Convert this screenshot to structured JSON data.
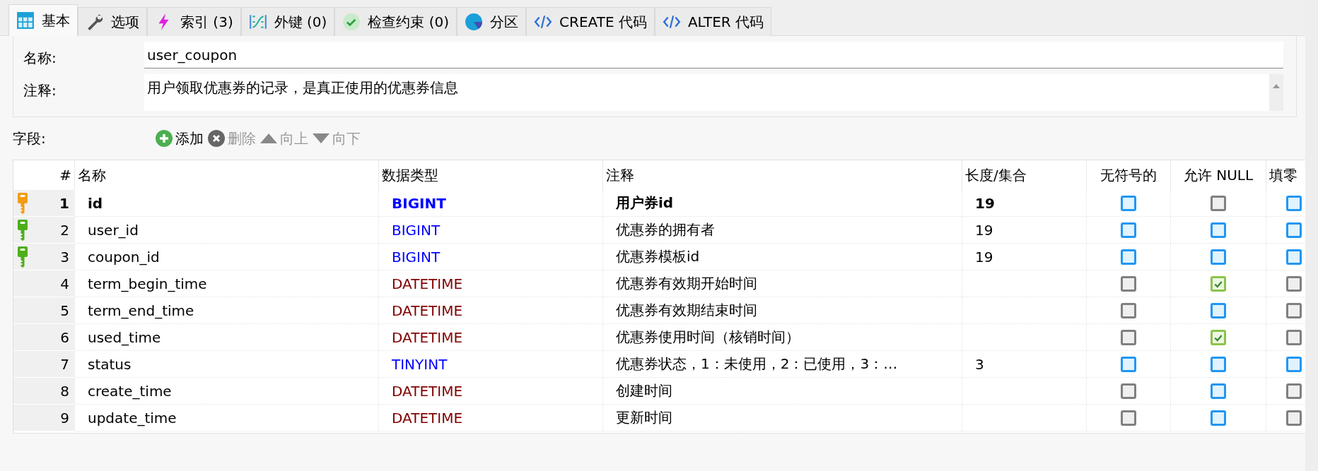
{
  "tabs": [
    {
      "label": "基本",
      "selected": true
    },
    {
      "label": "选项",
      "selected": false
    },
    {
      "label": "索引 (3)",
      "selected": false
    },
    {
      "label": "外键 (0)",
      "selected": false
    },
    {
      "label": "检查约束 (0)",
      "selected": false
    },
    {
      "label": "分区",
      "selected": false
    },
    {
      "label": "CREATE 代码",
      "selected": false
    },
    {
      "label": "ALTER 代码",
      "selected": false
    }
  ],
  "form": {
    "name_label": "名称:",
    "name_value": "user_coupon",
    "comment_label": "注释:",
    "comment_value": "用户领取优惠券的记录，是真正使用的优惠券信息"
  },
  "toolbar": {
    "label": "字段:",
    "buttons": [
      {
        "label": "添加",
        "disabled": false
      },
      {
        "label": "删除",
        "disabled": true
      },
      {
        "label": "向上",
        "disabled": true
      },
      {
        "label": "向下",
        "disabled": true
      }
    ]
  },
  "table": {
    "columns": [
      "#",
      "名称",
      "数据类型",
      "注释",
      "长度/集合",
      "无符号的",
      "允许 NULL",
      "填零"
    ],
    "rows": [
      {
        "kind": "primary",
        "selected": true,
        "num": "1",
        "name": "id",
        "type": "BIGINT",
        "color": "#0000ff",
        "comment": "用户券id",
        "length": "19",
        "unsigned": {
          "checked": false,
          "disabled": false
        },
        "null": {
          "checked": false,
          "disabled": true
        },
        "zerofill": {
          "checked": false,
          "disabled": false
        }
      },
      {
        "kind": "index",
        "selected": false,
        "num": "2",
        "name": "user_id",
        "type": "BIGINT",
        "color": "#0000ff",
        "comment": "优惠券的拥有者",
        "length": "19",
        "unsigned": {
          "checked": false,
          "disabled": false
        },
        "null": {
          "checked": false,
          "disabled": false
        },
        "zerofill": {
          "checked": false,
          "disabled": false
        }
      },
      {
        "kind": "index",
        "selected": false,
        "num": "3",
        "name": "coupon_id",
        "type": "BIGINT",
        "color": "#0000ff",
        "comment": "优惠券模板id",
        "length": "19",
        "unsigned": {
          "checked": false,
          "disabled": false
        },
        "null": {
          "checked": false,
          "disabled": false
        },
        "zerofill": {
          "checked": false,
          "disabled": false
        }
      },
      {
        "kind": "plain",
        "selected": false,
        "num": "4",
        "name": "term_begin_time",
        "type": "DATETIME",
        "color": "#800000",
        "comment": "优惠券有效期开始时间",
        "unsigned": {
          "checked": false,
          "disabled": true
        },
        "null": {
          "checked": true,
          "disabled": false
        },
        "zerofill": {
          "checked": false,
          "disabled": true
        }
      },
      {
        "kind": "plain",
        "selected": false,
        "num": "5",
        "name": "term_end_time",
        "type": "DATETIME",
        "color": "#800000",
        "comment": "优惠券有效期结束时间",
        "unsigned": {
          "checked": false,
          "disabled": true
        },
        "null": {
          "checked": false,
          "disabled": false
        },
        "zerofill": {
          "checked": false,
          "disabled": true
        }
      },
      {
        "kind": "plain",
        "selected": false,
        "num": "6",
        "name": "used_time",
        "type": "DATETIME",
        "color": "#800000",
        "comment": "优惠券使用时间（核销时间）",
        "unsigned": {
          "checked": false,
          "disabled": true
        },
        "null": {
          "checked": true,
          "disabled": false
        },
        "zerofill": {
          "checked": false,
          "disabled": true
        }
      },
      {
        "kind": "plain",
        "selected": false,
        "num": "7",
        "name": "status",
        "type": "TINYINT",
        "color": "#0000ff",
        "comment": "优惠券状态，1：未使用，2：已使用，3：…",
        "length": "3",
        "unsigned": {
          "checked": false,
          "disabled": false
        },
        "null": {
          "checked": false,
          "disabled": false
        },
        "zerofill": {
          "checked": false,
          "disabled": false
        }
      },
      {
        "kind": "plain",
        "selected": false,
        "num": "8",
        "name": "create_time",
        "type": "DATETIME",
        "color": "#800000",
        "comment": "创建时间",
        "unsigned": {
          "checked": false,
          "disabled": true
        },
        "null": {
          "checked": false,
          "disabled": false
        },
        "zerofill": {
          "checked": false,
          "disabled": true
        }
      },
      {
        "kind": "plain",
        "selected": false,
        "num": "9",
        "name": "update_time",
        "type": "DATETIME",
        "color": "#800000",
        "comment": "更新时间",
        "unsigned": {
          "checked": false,
          "disabled": true
        },
        "null": {
          "checked": false,
          "disabled": false
        },
        "zerofill": {
          "checked": false,
          "disabled": true
        }
      }
    ]
  }
}
